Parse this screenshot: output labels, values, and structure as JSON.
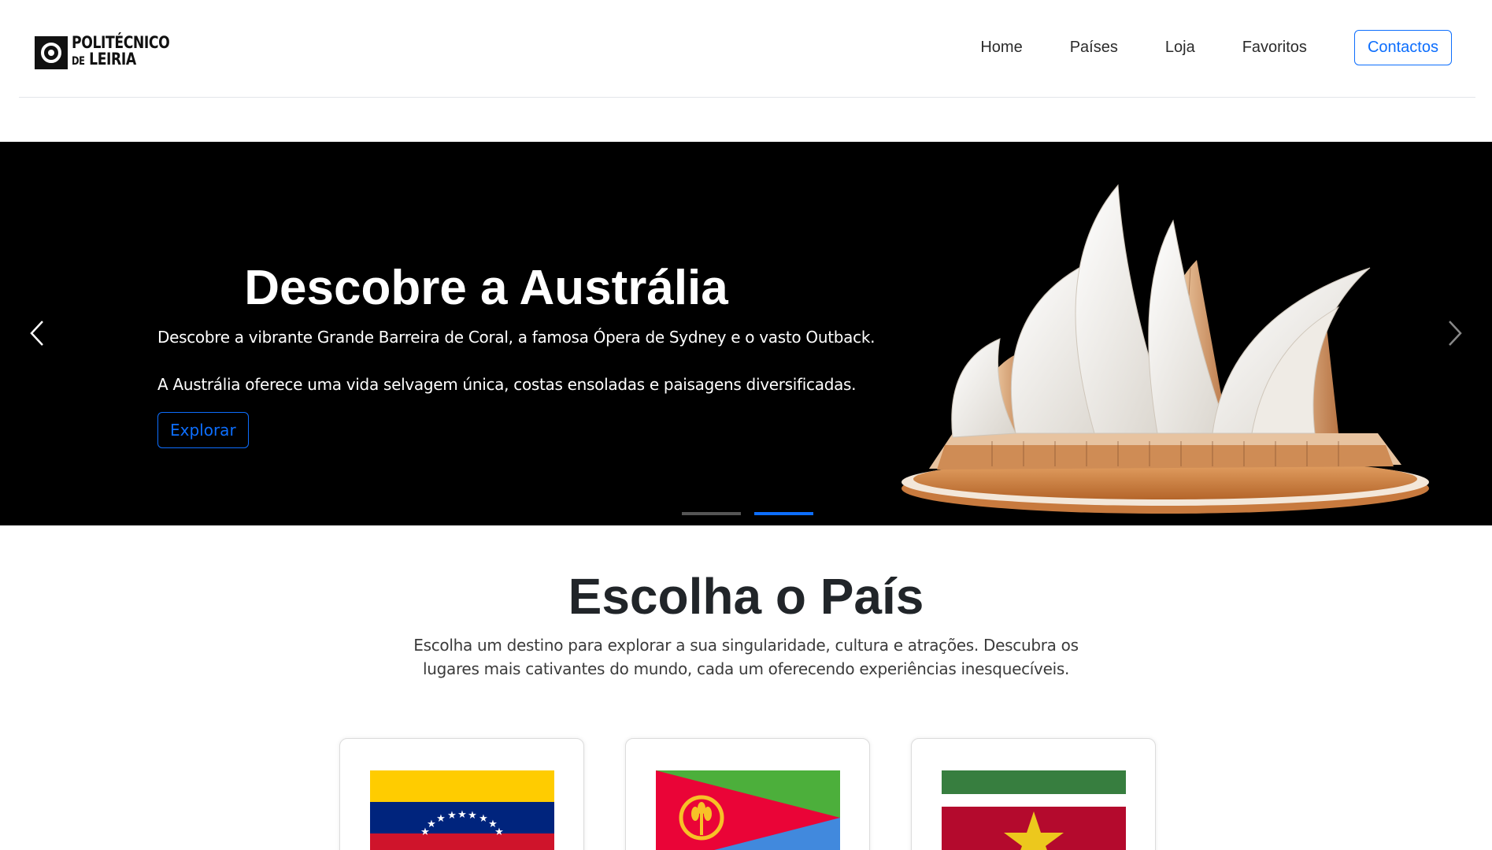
{
  "brand": {
    "line1": "POLITÉCNICO",
    "line2_small": "DE",
    "line2": "LEIRIA"
  },
  "nav": {
    "items": [
      "Home",
      "Países",
      "Loja",
      "Favoritos"
    ],
    "contact": "Contactos"
  },
  "carousel": {
    "title": "Descobre a Austrália",
    "paragraph1": "Descobre a vibrante Grande Barreira de Coral, a famosa Ópera de Sydney e o vasto Outback.",
    "paragraph2": "A Austrália oferece uma vida selvagem única, costas ensoladas e paisagens diversificadas.",
    "button": "Explorar",
    "slide_count": 2,
    "active_slide": 2,
    "image": "sydney-opera-house",
    "colors": {
      "accent": "#0d6efd",
      "background": "#000000"
    }
  },
  "countries": {
    "title": "Escolha o País",
    "description": "Escolha um destino para explorar a sua singularidade, cultura e atrações. Descubra os lugares mais cativantes do mundo, cada um oferecendo experiências inesquecíveis.",
    "cards": [
      {
        "flag": "venezuela-flag"
      },
      {
        "flag": "eritrea-flag"
      },
      {
        "flag": "suriname-flag"
      }
    ]
  }
}
